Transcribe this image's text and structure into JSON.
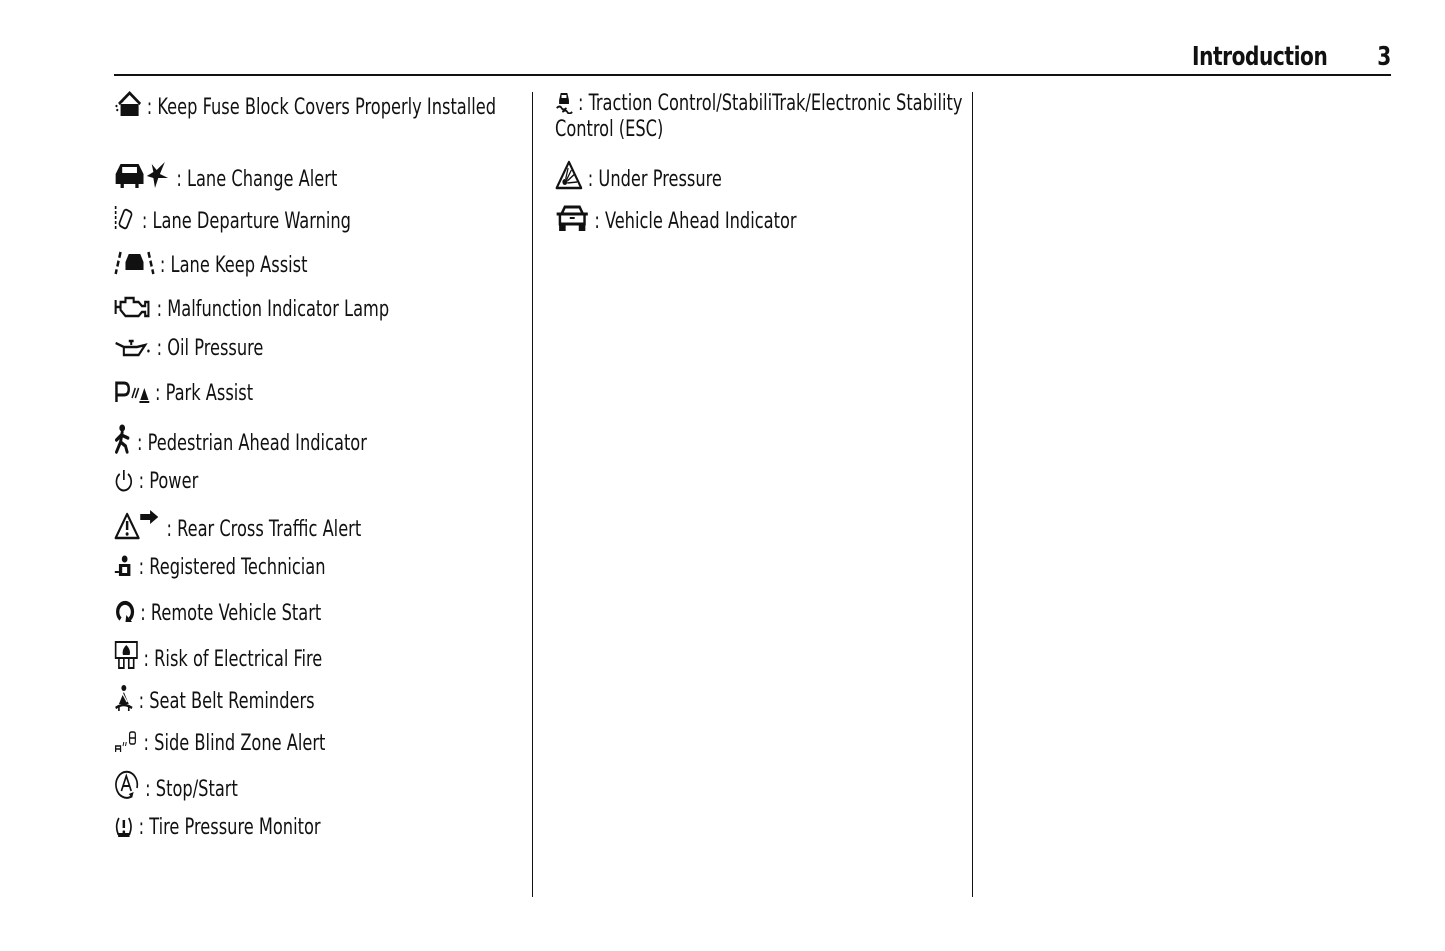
{
  "header": {
    "title": "Introduction",
    "page_number": "3"
  },
  "column_left": [
    {
      "icon": "fuse-block-cover-icon",
      "label": "Keep Fuse Block Covers Properly Installed"
    },
    {
      "icon": "lane-change-alert-icon",
      "label": "Lane Change Alert"
    },
    {
      "icon": "lane-departure-warning-icon",
      "label": "Lane Departure Warning"
    },
    {
      "icon": "lane-keep-assist-icon",
      "label": "Lane Keep Assist"
    },
    {
      "icon": "engine-icon",
      "label": "Malfunction Indicator Lamp"
    },
    {
      "icon": "oil-can-icon",
      "label": "Oil Pressure"
    },
    {
      "icon": "park-assist-icon",
      "label": "Park Assist"
    },
    {
      "icon": "pedestrian-icon",
      "label": "Pedestrian Ahead Indicator"
    },
    {
      "icon": "power-icon",
      "label": "Power"
    },
    {
      "icon": "rear-cross-traffic-icon",
      "label": "Rear Cross Traffic Alert"
    },
    {
      "icon": "registered-technician-icon",
      "label": "Registered Technician"
    },
    {
      "icon": "remote-start-icon",
      "label": "Remote Vehicle Start"
    },
    {
      "icon": "electrical-fire-icon",
      "label": "Risk of Electrical Fire"
    },
    {
      "icon": "seat-belt-icon",
      "label": "Seat Belt Reminders"
    },
    {
      "icon": "side-blind-zone-icon",
      "label": "Side Blind Zone Alert"
    },
    {
      "icon": "stop-start-icon",
      "label": "Stop/Start"
    },
    {
      "icon": "tire-pressure-icon",
      "label": "Tire Pressure Monitor"
    }
  ],
  "column_right": [
    {
      "icon": "traction-control-icon",
      "label": "Traction Control/StabiliTrak/Electronic Stability Control (ESC)"
    },
    {
      "icon": "under-pressure-icon",
      "label": "Under Pressure"
    },
    {
      "icon": "vehicle-ahead-icon",
      "label": "Vehicle Ahead Indicator"
    }
  ],
  "separator": ": "
}
